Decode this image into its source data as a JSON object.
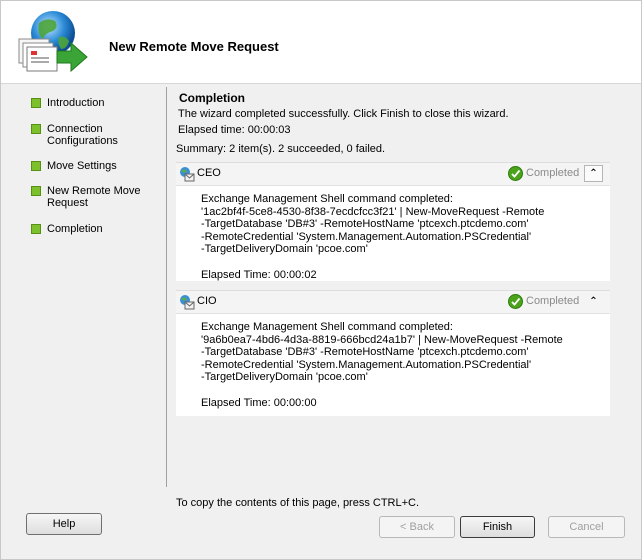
{
  "window": {
    "title": "New Remote Move Request"
  },
  "nav": {
    "items": [
      {
        "label": "Introduction"
      },
      {
        "label": "Connection Configurations"
      },
      {
        "label": "Move Settings"
      },
      {
        "label": "New Remote Move Request"
      },
      {
        "label": "Completion"
      }
    ]
  },
  "content": {
    "section_title": "Completion",
    "message": "The wizard completed successfully. Click Finish to close this wizard.",
    "elapsed": "Elapsed time: 00:00:03",
    "summary": "Summary: 2 item(s). 2 succeeded, 0 failed.",
    "panels": [
      {
        "name": "CEO",
        "status": "Completed",
        "lines": [
          "Exchange Management Shell command completed:",
          "'1ac2bf4f-5ce8-4530-8f38-7ecdcfcc3f21' | New-MoveRequest -Remote",
          "-TargetDatabase 'DB#3' -RemoteHostName 'ptcexch.ptcdemo.com'",
          "-RemoteCredential 'System.Management.Automation.PSCredential'",
          "-TargetDeliveryDomain 'pcoe.com'"
        ],
        "elapsed": "Elapsed Time: 00:00:02"
      },
      {
        "name": "CIO",
        "status": "Completed",
        "lines": [
          "Exchange Management Shell command completed:",
          "'9a6b0ea7-4bd6-4d3a-8819-666bcd24a1b7' | New-MoveRequest -Remote",
          "-TargetDatabase 'DB#3' -RemoteHostName 'ptcexch.ptcdemo.com'",
          "-RemoteCredential 'System.Management.Automation.PSCredential'",
          "-TargetDeliveryDomain 'pcoe.com'"
        ],
        "elapsed": "Elapsed Time: 00:00:00"
      }
    ],
    "copy_note": "To copy the contents of this page, press CTRL+C."
  },
  "buttons": {
    "help": "Help",
    "back": "< Back",
    "finish": "Finish",
    "cancel": "Cancel"
  },
  "icons": {
    "header": "exchange-wizard-globe-icon",
    "nav_bullet": "green-square-bullet-icon",
    "mailbox": "mailbox-user-icon",
    "status": "green-check-icon",
    "collapse": "double-chevron-up-icon"
  },
  "colors": {
    "nav_bullet": "#7cc12b",
    "status_ok": "#4aa31a",
    "status_text": "#8a8a8a"
  }
}
